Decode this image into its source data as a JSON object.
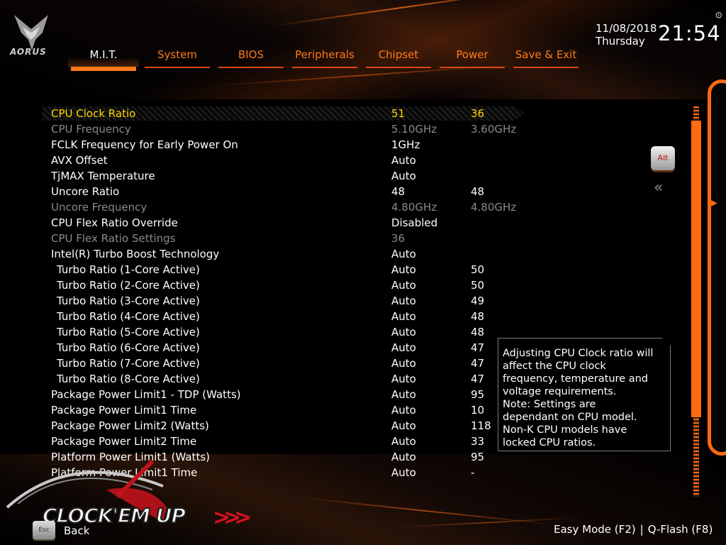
{
  "brand": {
    "logo_text": "AORUS"
  },
  "tabs": [
    {
      "label": "M.I.T.",
      "active": true
    },
    {
      "label": "System"
    },
    {
      "label": "BIOS"
    },
    {
      "label": "Peripherals"
    },
    {
      "label": "Chipset"
    },
    {
      "label": "Power"
    },
    {
      "label": "Save & Exit"
    }
  ],
  "clock": {
    "date": "11/08/2018",
    "day": "Thursday",
    "time": "21:54"
  },
  "settings": [
    {
      "name": "CPU Clock Ratio",
      "v1": "51",
      "v2": "36"
    },
    {
      "name": "CPU Frequency",
      "v1": "5.10GHz",
      "v2": "3.60GHz"
    },
    {
      "name": "FCLK Frequency for Early Power On",
      "v1": "1GHz",
      "v2": ""
    },
    {
      "name": "AVX Offset",
      "v1": "Auto",
      "v2": ""
    },
    {
      "name": "TjMAX Temperature",
      "v1": "Auto",
      "v2": ""
    },
    {
      "name": "Uncore Ratio",
      "v1": "48",
      "v2": "48"
    },
    {
      "name": "Uncore Frequency",
      "v1": "4.80GHz",
      "v2": "4.80GHz"
    },
    {
      "name": "CPU Flex Ratio Override",
      "v1": "Disabled",
      "v2": ""
    },
    {
      "name": "CPU Flex Ratio Settings",
      "v1": "36",
      "v2": ""
    },
    {
      "name": "Intel(R) Turbo Boost Technology",
      "v1": "Auto",
      "v2": ""
    },
    {
      "name": "Turbo Ratio (1-Core Active)",
      "v1": "Auto",
      "v2": "50"
    },
    {
      "name": "Turbo Ratio (2-Core Active)",
      "v1": "Auto",
      "v2": "50"
    },
    {
      "name": "Turbo Ratio (3-Core Active)",
      "v1": "Auto",
      "v2": "49"
    },
    {
      "name": "Turbo Ratio (4-Core Active)",
      "v1": "Auto",
      "v2": "48"
    },
    {
      "name": "Turbo Ratio (5-Core Active)",
      "v1": "Auto",
      "v2": "48"
    },
    {
      "name": "Turbo Ratio (6-Core Active)",
      "v1": "Auto",
      "v2": "47"
    },
    {
      "name": "Turbo Ratio (7-Core Active)",
      "v1": "Auto",
      "v2": "47"
    },
    {
      "name": "Turbo Ratio (8-Core Active)",
      "v1": "Auto",
      "v2": "47"
    },
    {
      "name": "Package Power Limit1 - TDP (Watts)",
      "v1": "Auto",
      "v2": "95"
    },
    {
      "name": "Package Power Limit1 Time",
      "v1": "Auto",
      "v2": "10"
    },
    {
      "name": "Package Power Limit2 (Watts)",
      "v1": "Auto",
      "v2": "118"
    },
    {
      "name": "Package Power Limit2 Time",
      "v1": "Auto",
      "v2": "33"
    },
    {
      "name": "Platform Power Limit1 (Watts)",
      "v1": "Auto",
      "v2": "95"
    },
    {
      "name": "Platform Power Limit1 Time",
      "v1": "Auto",
      "v2": "-"
    }
  ],
  "help": {
    "lines": [
      "Adjusting CPU Clock ratio will",
      "affect the CPU clock",
      "frequency, temperature and",
      "voltage requirements.",
      "Note: Settings are",
      "dependant  on  CPU model.",
      "Non-K CPU models have",
      "locked CPU ratios."
    ]
  },
  "side": {
    "alt_key": "Alt"
  },
  "bottom": {
    "esc_key": "Esc",
    "back_label": "Back",
    "easy_mode": "Easy Mode (F2)",
    "separator": "|",
    "qflash": "Q-Flash (F8)",
    "watermark": "CLOCK'EM UP"
  },
  "colors": {
    "accent": "#ff7a1a",
    "selected_text": "#ffd400",
    "disabled_text": "#8a8a8a"
  }
}
